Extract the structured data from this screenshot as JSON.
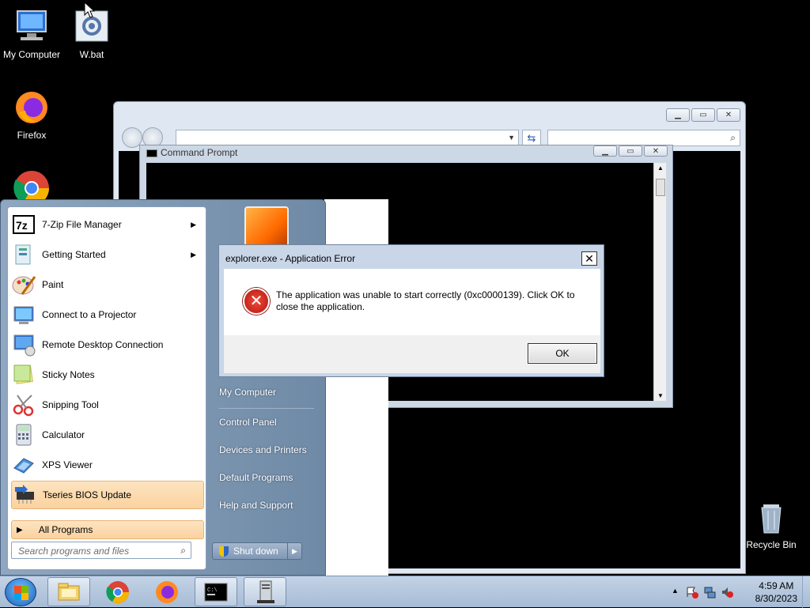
{
  "desktop": {
    "icons": [
      {
        "label": "My Computer",
        "icon": "computer-icon"
      },
      {
        "label": "W.bat",
        "icon": "batch-file-icon"
      },
      {
        "label": "Firefox",
        "icon": "firefox-icon"
      },
      {
        "label": "",
        "icon": "chrome-icon"
      },
      {
        "label": "Recycle Bin",
        "icon": "recycle-bin-icon"
      }
    ]
  },
  "cmd_window": {
    "title": "Command Prompt"
  },
  "start_menu": {
    "programs": [
      {
        "label": "7-Zip File Manager",
        "icon": "7zip-icon",
        "submenu": true
      },
      {
        "label": "Getting Started",
        "icon": "getting-started-icon",
        "submenu": true
      },
      {
        "label": "Paint",
        "icon": "paint-icon",
        "submenu": false
      },
      {
        "label": "Connect to a Projector",
        "icon": "projector-icon",
        "submenu": false
      },
      {
        "label": "Remote Desktop Connection",
        "icon": "remote-desktop-icon",
        "submenu": false
      },
      {
        "label": "Sticky Notes",
        "icon": "sticky-notes-icon",
        "submenu": false
      },
      {
        "label": "Snipping Tool",
        "icon": "snipping-tool-icon",
        "submenu": false
      },
      {
        "label": "Calculator",
        "icon": "calculator-icon",
        "submenu": false
      },
      {
        "label": "XPS Viewer",
        "icon": "xps-viewer-icon",
        "submenu": false
      },
      {
        "label": "Tseries BIOS Update",
        "icon": "bios-update-icon",
        "submenu": false
      }
    ],
    "all_programs": "All Programs",
    "search_placeholder": "Search programs and files",
    "right_links": [
      "My Computer",
      "Control Panel",
      "Devices and Printers",
      "Default Programs",
      "Help and Support"
    ],
    "shutdown": "Shut down"
  },
  "dialog": {
    "title": "explorer.exe - Application Error",
    "message": "The application was unable to start correctly (0xc0000139). Click OK to close the application.",
    "ok": "OK"
  },
  "taskbar": {
    "apps": [
      "explorer-icon",
      "chrome-icon",
      "firefox-icon",
      "cmd-icon",
      "server-icon"
    ],
    "time": "4:59 AM",
    "date": "8/30/2023"
  },
  "colors": {
    "accent": "#1c5fb8",
    "highlight": "#fbd2a0",
    "error": "#d02a1c"
  }
}
